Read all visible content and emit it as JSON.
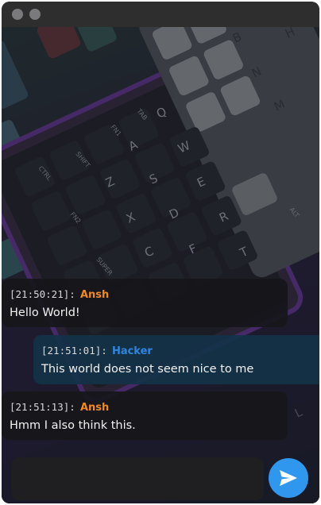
{
  "window": {
    "dots": [
      "window-dot-1",
      "window-dot-2"
    ]
  },
  "messages": [
    {
      "time": "[21:50:21]:",
      "sender": "Ansh",
      "sender_color": "#f0891e",
      "text": "Hello World!",
      "direction": "incoming"
    },
    {
      "time": "[21:51:01]:",
      "sender": "Hacker",
      "sender_color": "#2f86e0",
      "text": "This world does not seem nice to me",
      "direction": "outgoing"
    },
    {
      "time": "[21:51:13]:",
      "sender": "Ansh",
      "sender_color": "#f0891e",
      "text": "Hmm I also think this.",
      "direction": "incoming"
    }
  ],
  "composer": {
    "value": "",
    "placeholder": ""
  },
  "send_button": {
    "icon": "send-icon",
    "color": "#2f97ee"
  },
  "keyboard_keys": {
    "tab": "TAB",
    "fn1": "FN1",
    "shift": "SHIFT",
    "ctrl": "CTRL",
    "fn2": "FN2",
    "super": "SUPER",
    "alt": "ALT",
    "q": "Q",
    "a": "A",
    "w": "W",
    "s": "S",
    "z": "Z",
    "e": "E",
    "d": "D",
    "x": "X",
    "r": "R",
    "c": "C",
    "f": "F",
    "t": "T",
    "b": "B",
    "n": "N",
    "m": "M",
    "h": "H",
    "l": "L"
  }
}
